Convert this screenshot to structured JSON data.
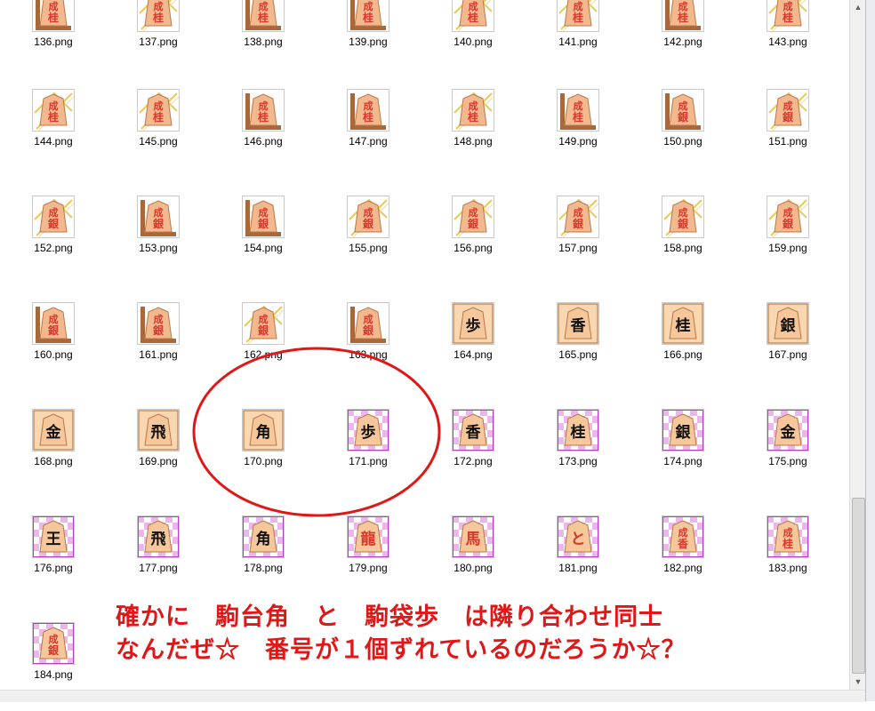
{
  "files": [
    {
      "name": "136.png",
      "style": "plain",
      "kanji": "成桂",
      "frame": "corner"
    },
    {
      "name": "137.png",
      "style": "plain",
      "kanji": "成桂",
      "frame": "x"
    },
    {
      "name": "138.png",
      "style": "plain",
      "kanji": "成桂",
      "frame": "corner"
    },
    {
      "name": "139.png",
      "style": "plain",
      "kanji": "成桂",
      "frame": "corner"
    },
    {
      "name": "140.png",
      "style": "plain",
      "kanji": "成桂",
      "frame": "x"
    },
    {
      "name": "141.png",
      "style": "plain",
      "kanji": "成桂",
      "frame": "x"
    },
    {
      "name": "142.png",
      "style": "plain",
      "kanji": "成桂",
      "frame": "corner"
    },
    {
      "name": "143.png",
      "style": "plain",
      "kanji": "成桂",
      "frame": "x"
    },
    {
      "name": "144.png",
      "style": "plain",
      "kanji": "成桂",
      "frame": "x"
    },
    {
      "name": "145.png",
      "style": "plain",
      "kanji": "成桂",
      "frame": "x"
    },
    {
      "name": "146.png",
      "style": "plain",
      "kanji": "成桂",
      "frame": "corner"
    },
    {
      "name": "147.png",
      "style": "plain",
      "kanji": "成桂",
      "frame": "corner"
    },
    {
      "name": "148.png",
      "style": "plain",
      "kanji": "成桂",
      "frame": "x"
    },
    {
      "name": "149.png",
      "style": "plain",
      "kanji": "成桂",
      "frame": "corner"
    },
    {
      "name": "150.png",
      "style": "plain",
      "kanji": "成銀",
      "frame": "corner"
    },
    {
      "name": "151.png",
      "style": "plain",
      "kanji": "成銀",
      "frame": "x"
    },
    {
      "name": "152.png",
      "style": "plain",
      "kanji": "成銀",
      "frame": "x"
    },
    {
      "name": "153.png",
      "style": "plain",
      "kanji": "成銀",
      "frame": "corner"
    },
    {
      "name": "154.png",
      "style": "plain",
      "kanji": "成銀",
      "frame": "corner"
    },
    {
      "name": "155.png",
      "style": "plain",
      "kanji": "成銀",
      "frame": "x"
    },
    {
      "name": "156.png",
      "style": "plain",
      "kanji": "成銀",
      "frame": "x"
    },
    {
      "name": "157.png",
      "style": "plain",
      "kanji": "成銀",
      "frame": "x"
    },
    {
      "name": "158.png",
      "style": "plain",
      "kanji": "成銀",
      "frame": "x"
    },
    {
      "name": "159.png",
      "style": "plain",
      "kanji": "成銀",
      "frame": "x"
    },
    {
      "name": "160.png",
      "style": "plain",
      "kanji": "成銀",
      "frame": "corner"
    },
    {
      "name": "161.png",
      "style": "plain",
      "kanji": "成銀",
      "frame": "corner"
    },
    {
      "name": "162.png",
      "style": "plain",
      "kanji": "成銀",
      "frame": "x"
    },
    {
      "name": "163.png",
      "style": "plain",
      "kanji": "成銀",
      "frame": "corner"
    },
    {
      "name": "164.png",
      "style": "tile",
      "kanji": "歩",
      "frame": "none"
    },
    {
      "name": "165.png",
      "style": "tile",
      "kanji": "香",
      "frame": "none"
    },
    {
      "name": "166.png",
      "style": "tile",
      "kanji": "桂",
      "frame": "none"
    },
    {
      "name": "167.png",
      "style": "tile",
      "kanji": "銀",
      "frame": "none"
    },
    {
      "name": "168.png",
      "style": "tile",
      "kanji": "金",
      "frame": "none"
    },
    {
      "name": "169.png",
      "style": "tile",
      "kanji": "飛",
      "frame": "none"
    },
    {
      "name": "170.png",
      "style": "tile",
      "kanji": "角",
      "frame": "none"
    },
    {
      "name": "171.png",
      "style": "check",
      "kanji": "歩",
      "frame": "none"
    },
    {
      "name": "172.png",
      "style": "check",
      "kanji": "香",
      "frame": "none"
    },
    {
      "name": "173.png",
      "style": "check",
      "kanji": "桂",
      "frame": "none"
    },
    {
      "name": "174.png",
      "style": "check",
      "kanji": "銀",
      "frame": "none"
    },
    {
      "name": "175.png",
      "style": "check",
      "kanji": "金",
      "frame": "none"
    },
    {
      "name": "176.png",
      "style": "check",
      "kanji": "王",
      "frame": "none"
    },
    {
      "name": "177.png",
      "style": "check",
      "kanji": "飛",
      "frame": "none"
    },
    {
      "name": "178.png",
      "style": "check",
      "kanji": "角",
      "frame": "none"
    },
    {
      "name": "179.png",
      "style": "check",
      "kanji": "龍",
      "frame": "none",
      "red": true
    },
    {
      "name": "180.png",
      "style": "check",
      "kanji": "馬",
      "frame": "none",
      "red": true
    },
    {
      "name": "181.png",
      "style": "check",
      "kanji": "と",
      "frame": "none",
      "red": true
    },
    {
      "name": "182.png",
      "style": "check",
      "kanji": "成香",
      "frame": "none",
      "red": true
    },
    {
      "name": "183.png",
      "style": "check",
      "kanji": "成桂",
      "frame": "none",
      "red": true
    },
    {
      "name": "184.png",
      "style": "check",
      "kanji": "成銀",
      "frame": "none",
      "red": true
    }
  ],
  "annotation": {
    "line1": "確かに　駒台角　と　駒袋歩　は隣り合わせ同士",
    "line2": "なんだぜ☆　番号が１個ずれているのだろうか☆？"
  },
  "colors": {
    "annotation": "#e01717",
    "piece_fill": "#f6c79b",
    "piece_stroke": "#b8784a",
    "frame_brown": "#a8683c",
    "frame_gold": "#e8c860",
    "checker_pink": "#eab6ec",
    "tile_bg": "#f9d7b0"
  }
}
